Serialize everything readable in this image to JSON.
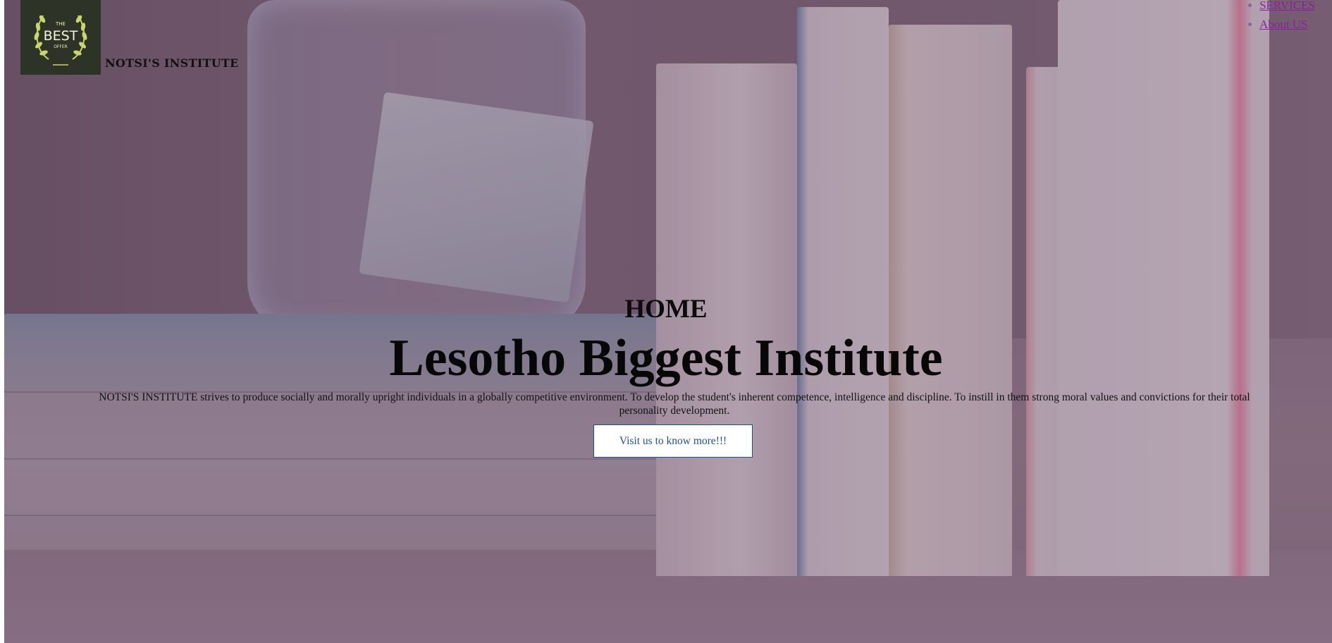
{
  "brand": {
    "logo_text_top": "THE",
    "logo_text_main": "BEST",
    "logo_text_bottom": "OFFER",
    "name": "NOTSI'S INSTITUTE"
  },
  "nav": {
    "items": [
      {
        "label": "SERVICES"
      },
      {
        "label": "About US"
      }
    ]
  },
  "hero": {
    "section_heading": "HOME",
    "title": "Lesotho Biggest Institute",
    "description": "NOTSI'S INSTITUTE strives to produce socially and morally upright individuals in a globally competitive environment. To develop the student's inherent competence, intelligence and discipline. To instill in them strong moral values and convictions for their total personality development.",
    "cta_label": "Visit us to know more!!!"
  },
  "colors": {
    "logo_background": "#2e3327",
    "logo_accent": "#c9d66a",
    "link": "#8a1fa0",
    "cta_border": "#1f4f8f",
    "overlay": "#4a3a62"
  },
  "icons": {
    "logo": "laurel-wreath-badge-icon",
    "nav_bullet": "bullet-dot-icon"
  }
}
